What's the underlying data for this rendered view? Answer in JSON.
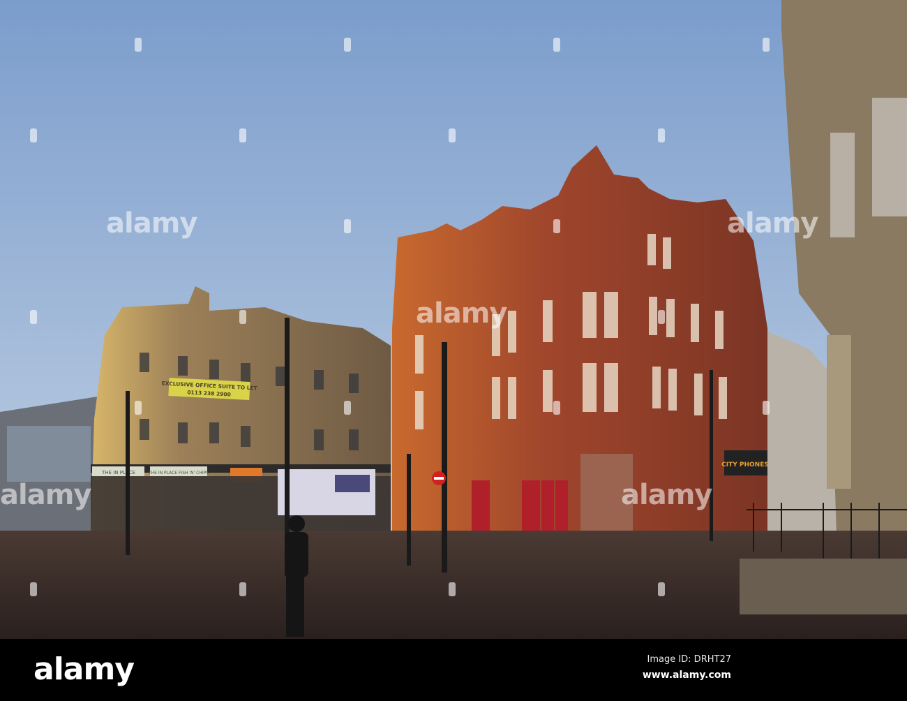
{
  "photo": {
    "watermark": "alamy",
    "signs": {
      "banner_line1": "EXCLUSIVE OFFICE SUITE TO LET",
      "banner_line2": "0113 238 2900",
      "shop_left": "THE IN PLACE",
      "shop_center": "THE IN PLACE  FISH 'N' CHIPS",
      "shop_right": "CITY PHONES"
    },
    "colors": {
      "sky_top": "#7b9dcc",
      "sky_bottom": "#c9d6e6",
      "red_brick": "#a0462c",
      "sandstone": "#a88a5a",
      "pavement": "#3a2d2a"
    }
  },
  "footer": {
    "logo": "alamy",
    "image_id": "Image ID: DRHT27",
    "url": "www.alamy.com"
  }
}
